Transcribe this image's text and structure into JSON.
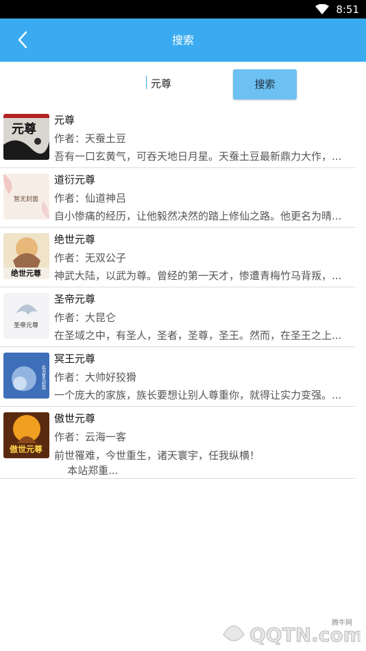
{
  "status_bar": {
    "time": "8:51"
  },
  "header": {
    "title": "搜索"
  },
  "search": {
    "value": "元尊",
    "button_label": "搜索"
  },
  "results": [
    {
      "title": "元尊",
      "author": "作者：天蚕土豆",
      "description": "吾有一口玄黄气，可吞天地日月星。天蚕土豆最新鼎力大作，..."
    },
    {
      "title": "道衍元尊",
      "author": "作者：仙道神吕",
      "description": "自小惨痛的经历，让他毅然决然的踏上修仙之路。他更名为晴..."
    },
    {
      "title": "绝世元尊",
      "author": "作者：无双公子",
      "description": "神武大陆，以武为尊。曾经的第一天才，惨遭青梅竹马背叛，..."
    },
    {
      "title": "圣帝元尊",
      "author": "作者：大昆仑",
      "description": "在圣域之中，有圣人，圣者，圣尊，圣王。然而，在圣王之上..."
    },
    {
      "title": "冥王元尊",
      "author": "作者：大帅好狡猾",
      "description": "一个庞大的家族，族长要想让别人尊重你，就得让实力变强。..."
    },
    {
      "title": "傲世元尊",
      "author": "作者：云海一客",
      "description": "前世罹难，今世重生，诸天寰宇，任我纵横！\n    本站郑重..."
    }
  ],
  "covers": [
    {
      "text": "元尊"
    },
    {
      "text": "暂无封面"
    },
    {
      "text": "绝世元尊"
    },
    {
      "text": "圣帝元尊"
    },
    {
      "text": "此书暂无封面"
    },
    {
      "text": "傲世元尊"
    }
  ],
  "watermark": {
    "text": "腾牛网",
    "brand": "QQTN.com"
  },
  "colors": {
    "accent": "#3aabf0",
    "button": "#6cc0f2"
  }
}
